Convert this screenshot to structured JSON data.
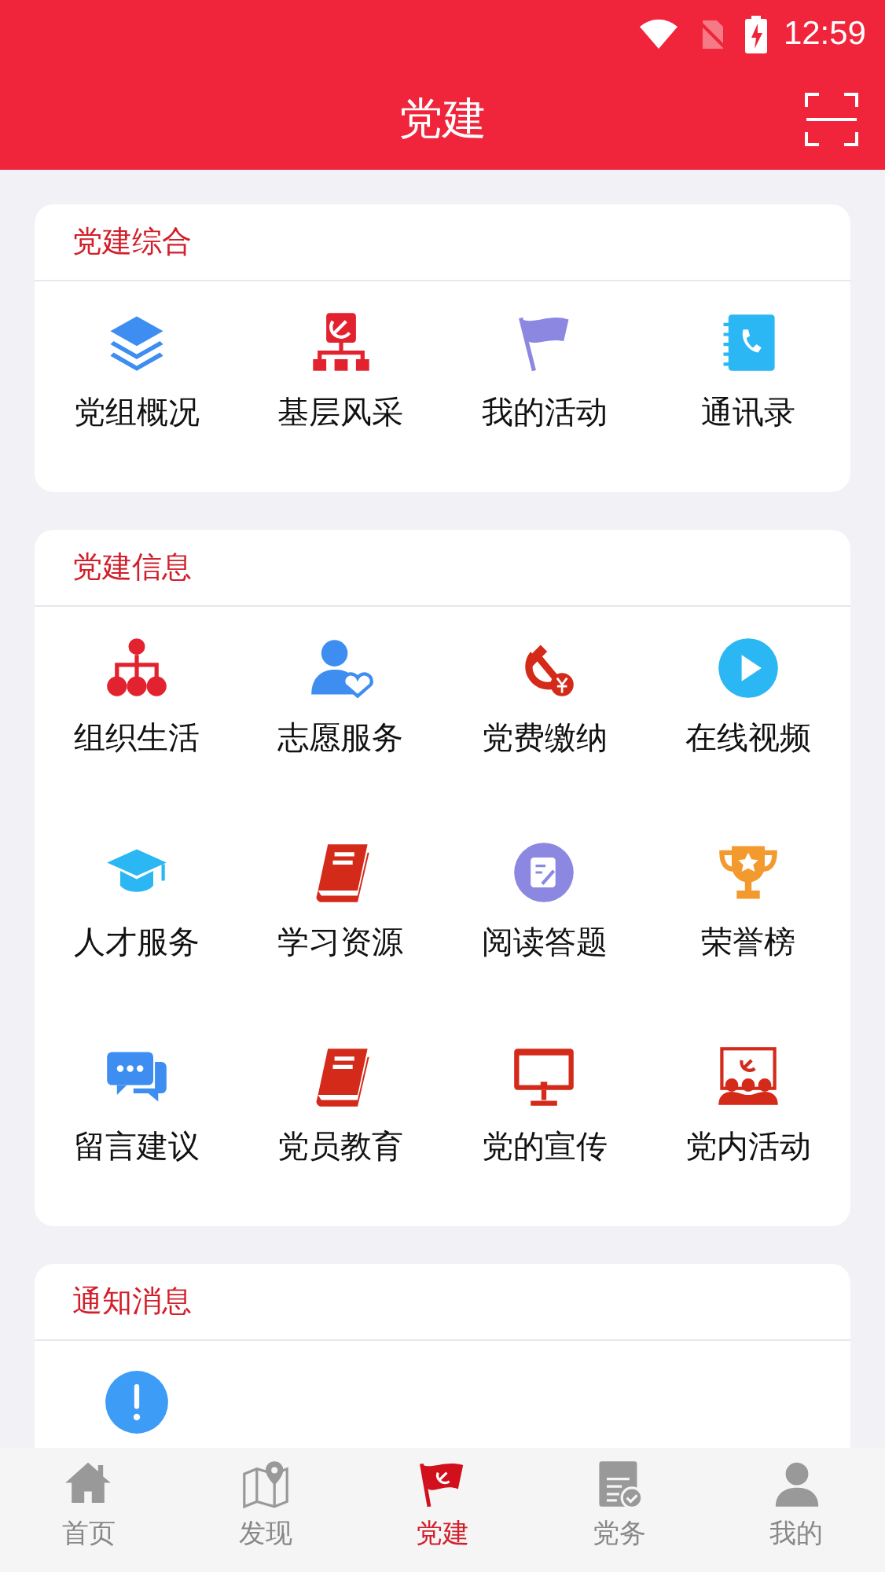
{
  "status_bar": {
    "time": "12:59"
  },
  "header": {
    "title": "党建"
  },
  "sections": [
    {
      "title": "党建综合",
      "items": [
        "党组概况",
        "基层风采",
        "我的活动",
        "通讯录"
      ]
    },
    {
      "title": "党建信息",
      "items": [
        "组织生活",
        "志愿服务",
        "党费缴纳",
        "在线视频",
        "人才服务",
        "学习资源",
        "阅读答题",
        "荣誉榜",
        "留言建议",
        "党员教育",
        "党的宣传",
        "党内活动"
      ]
    },
    {
      "title": "通知消息"
    }
  ],
  "bottom_nav": [
    {
      "label": "首页",
      "selected": false
    },
    {
      "label": "发现",
      "selected": false
    },
    {
      "label": "党建",
      "selected": true
    },
    {
      "label": "党务",
      "selected": false
    },
    {
      "label": "我的",
      "selected": false
    }
  ]
}
